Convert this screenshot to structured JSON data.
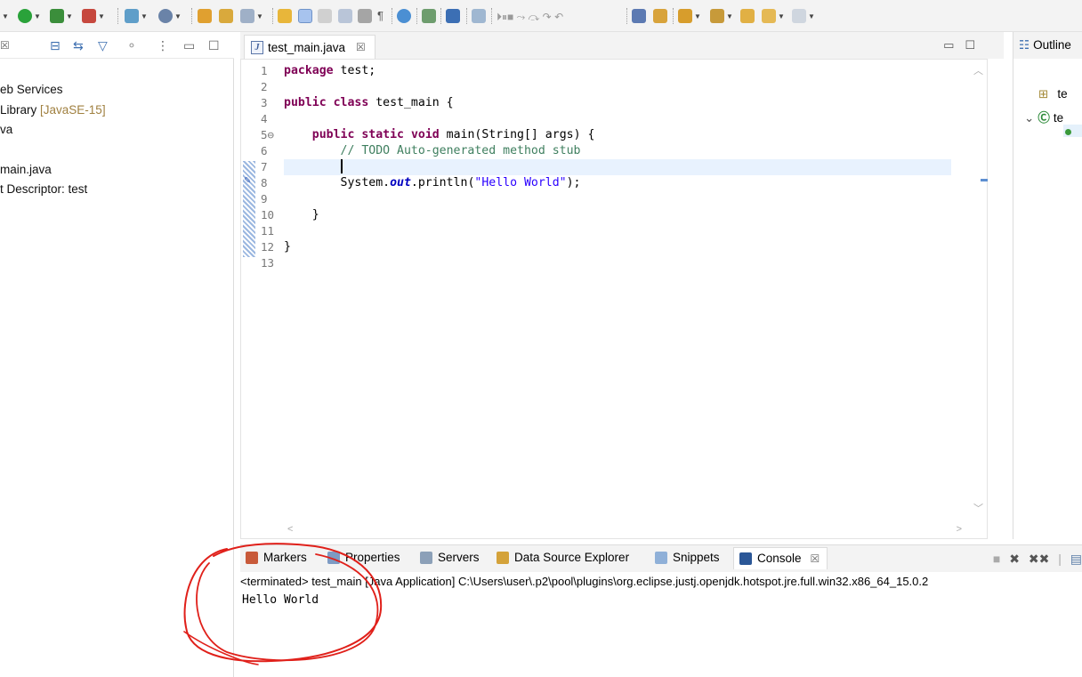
{
  "toolbar": {
    "icons": [
      "debug-dropdown-icon",
      "run-icon",
      "run-dropdown-icon",
      "coverage-icon",
      "coverage-dropdown-icon",
      "external-tools-icon",
      "new-server-icon",
      "open-type-icon",
      "open-task-icon",
      "search-icon",
      "toggle-mark-icon",
      "annotations-icon",
      "toggle-breadcrumb-icon",
      "block-selection-icon",
      "show-whitespace-icon",
      "web-browser-icon",
      "deploy-icon",
      "console-icon",
      "skip-breakpoints-icon",
      "resume-icon",
      "suspend-icon",
      "terminate-icon",
      "disconnect-icon",
      "step-into-icon",
      "step-over-icon",
      "step-return-icon",
      "drop-to-frame-icon",
      "use-step-filters-icon",
      "next-annotation-icon",
      "prev-annotation-icon",
      "last-edit-icon",
      "back-icon",
      "forward-icon"
    ]
  },
  "left_panel": {
    "tab_close": "☒",
    "tree": [
      {
        "label": "eb Services",
        "decoration": ""
      },
      {
        "label": "Library",
        "decoration": "[JavaSE-15]"
      },
      {
        "label": "va",
        "decoration": ""
      },
      {
        "label": "main.java",
        "decoration": ""
      },
      {
        "label": "t Descriptor: test",
        "decoration": ""
      }
    ]
  },
  "editor": {
    "tab_label": "test_main.java",
    "tab_close": "☒",
    "line_numbers": [
      "1",
      "2",
      "3",
      "4",
      "5⊖",
      "6",
      "7",
      "8",
      "9",
      "10",
      "11",
      "12",
      "13"
    ],
    "code": {
      "l1_kw": "package",
      "l1_rest": " test;",
      "l3_kw1": "public",
      "l3_kw2": "class",
      "l3_rest": " test_main {",
      "l5_indent": "    ",
      "l5_kw1": "public",
      "l5_kw2": "static",
      "l5_kw3": "void",
      "l5_rest": " main(String[] args) {",
      "l6_comment": "        // TODO Auto-generated method stub",
      "l7_indent": "        ",
      "l8_pre": "        System.",
      "l8_field": "out",
      "l8_mid": ".println(",
      "l8_str": "\"Hello World\"",
      "l8_end": ");",
      "l10": "    }",
      "l12": "}"
    }
  },
  "outline": {
    "title": "Outline",
    "items": [
      "te",
      "te"
    ]
  },
  "bottom": {
    "tabs": [
      {
        "label": "Markers"
      },
      {
        "label": "Properties"
      },
      {
        "label": "Servers"
      },
      {
        "label": "Data Source Explorer"
      },
      {
        "label": "Snippets"
      },
      {
        "label": "Console"
      }
    ],
    "console_close": "☒",
    "status": "<terminated> test_main [Java Application] C:\\Users\\user\\.p2\\pool\\plugins\\org.eclipse.justj.openjdk.hotspot.jre.full.win32.x86_64_15.0.2",
    "output": "Hello World"
  },
  "colors": {
    "keyword": "#7f0055",
    "comment": "#3f7f5f",
    "string": "#2a00ff",
    "annotation_circle": "#e0201a"
  }
}
